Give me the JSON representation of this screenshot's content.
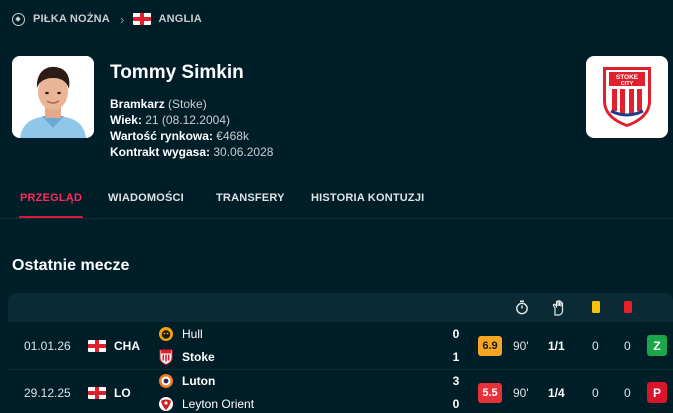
{
  "breadcrumb": {
    "sport": "PIŁKA NOŻNA",
    "country": "ANGLIA"
  },
  "player": {
    "name": "Tommy Simkin",
    "position_label": "Bramkarz",
    "club_paren": "(Stoke)",
    "age_label": "Wiek:",
    "age_value": "21 (08.12.2004)",
    "value_label": "Wartość rynkowa:",
    "value_value": "€468k",
    "contract_label": "Kontrakt wygasa:",
    "contract_value": "30.06.2028",
    "club_logo_text": "STOKE CITY"
  },
  "tabs": [
    {
      "label": "PRZEGLĄD",
      "active": true
    },
    {
      "label": "WIADOMOŚCI",
      "active": false
    },
    {
      "label": "TRANSFERY",
      "active": false
    },
    {
      "label": "HISTORIA KONTUZJI",
      "active": false
    }
  ],
  "recent_matches": {
    "title": "Ostatnie mecze",
    "header_icons": [
      "stopwatch-icon",
      "glove-icon",
      "yellow-card-icon",
      "red-card-icon"
    ],
    "rows": [
      {
        "date": "01.01.26",
        "competition": "CHA",
        "home_team": "Hull",
        "away_team": "Stoke",
        "home_score": "0",
        "away_score": "1",
        "rating": "6.9",
        "rating_color": "#f5a524",
        "minutes": "90'",
        "saves": "1/1",
        "yellow_cards": "0",
        "red_cards": "0",
        "result": "Z",
        "result_color": "#1aa64a"
      },
      {
        "date": "29.12.25",
        "competition": "LO",
        "home_team": "Luton",
        "away_team": "Leyton Orient",
        "home_score": "3",
        "away_score": "0",
        "rating": "5.5",
        "rating_color": "#e8303b",
        "minutes": "90'",
        "saves": "1/4",
        "yellow_cards": "0",
        "red_cards": "0",
        "result": "P",
        "result_color": "#d8152b"
      }
    ]
  }
}
